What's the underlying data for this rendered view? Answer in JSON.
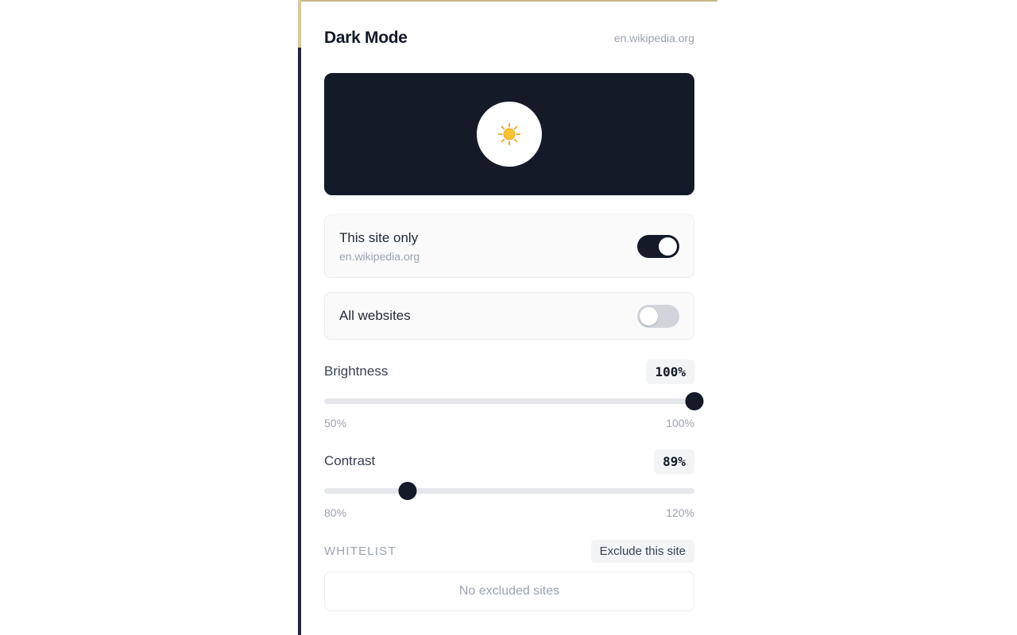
{
  "header": {
    "title": "Dark Mode",
    "domain": "en.wikipedia.org"
  },
  "preview": {
    "toggle_icon": "sun-icon",
    "background_color": "#141a28"
  },
  "site_toggle": {
    "label": "This site only",
    "sublabel": "en.wikipedia.org",
    "enabled": true
  },
  "all_toggle": {
    "label": "All websites",
    "enabled": false
  },
  "brightness": {
    "label": "Brightness",
    "value_text": "100%",
    "value": 100,
    "min": 50,
    "max": 100,
    "min_label": "50%",
    "max_label": "100%"
  },
  "contrast": {
    "label": "Contrast",
    "value_text": "89%",
    "value": 89,
    "min": 80,
    "max": 120,
    "min_label": "80%",
    "max_label": "120%"
  },
  "whitelist": {
    "title": "WHITELIST",
    "exclude_label": "Exclude this site",
    "empty_text": "No excluded sites"
  },
  "colors": {
    "accent": "#141a28",
    "muted": "#9ca3af",
    "track": "#e5e7eb",
    "toggle_off": "#d1d5db"
  }
}
